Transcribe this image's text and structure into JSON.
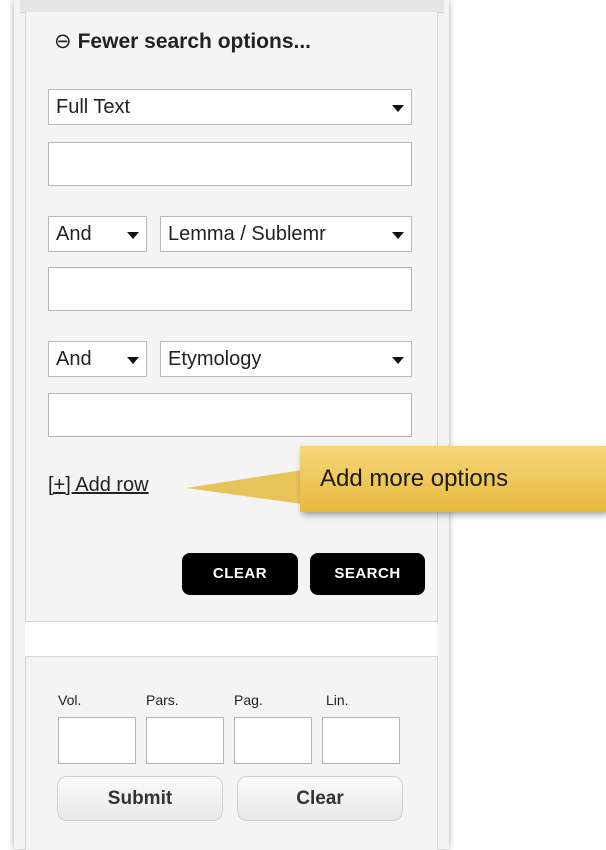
{
  "search_panel": {
    "toggle_icon": "⊖",
    "toggle_label": "Fewer search options...",
    "rows": [
      {
        "field": "Full Text",
        "value": ""
      },
      {
        "operator": "And",
        "field": "Lemma / Sublemr",
        "value": ""
      },
      {
        "operator": "And",
        "field": "Etymology",
        "value": ""
      }
    ],
    "add_row_label": "[+] Add row",
    "clear_label": "CLEAR",
    "search_label": "SEARCH"
  },
  "tooltip": {
    "text": "Add more options",
    "color": "#e8b93f"
  },
  "citation_panel": {
    "fields": [
      {
        "label": "Vol.",
        "value": ""
      },
      {
        "label": "Pars.",
        "value": ""
      },
      {
        "label": "Pag.",
        "value": ""
      },
      {
        "label": "Lin.",
        "value": ""
      }
    ],
    "submit_label": "Submit",
    "clear_label": "Clear"
  }
}
